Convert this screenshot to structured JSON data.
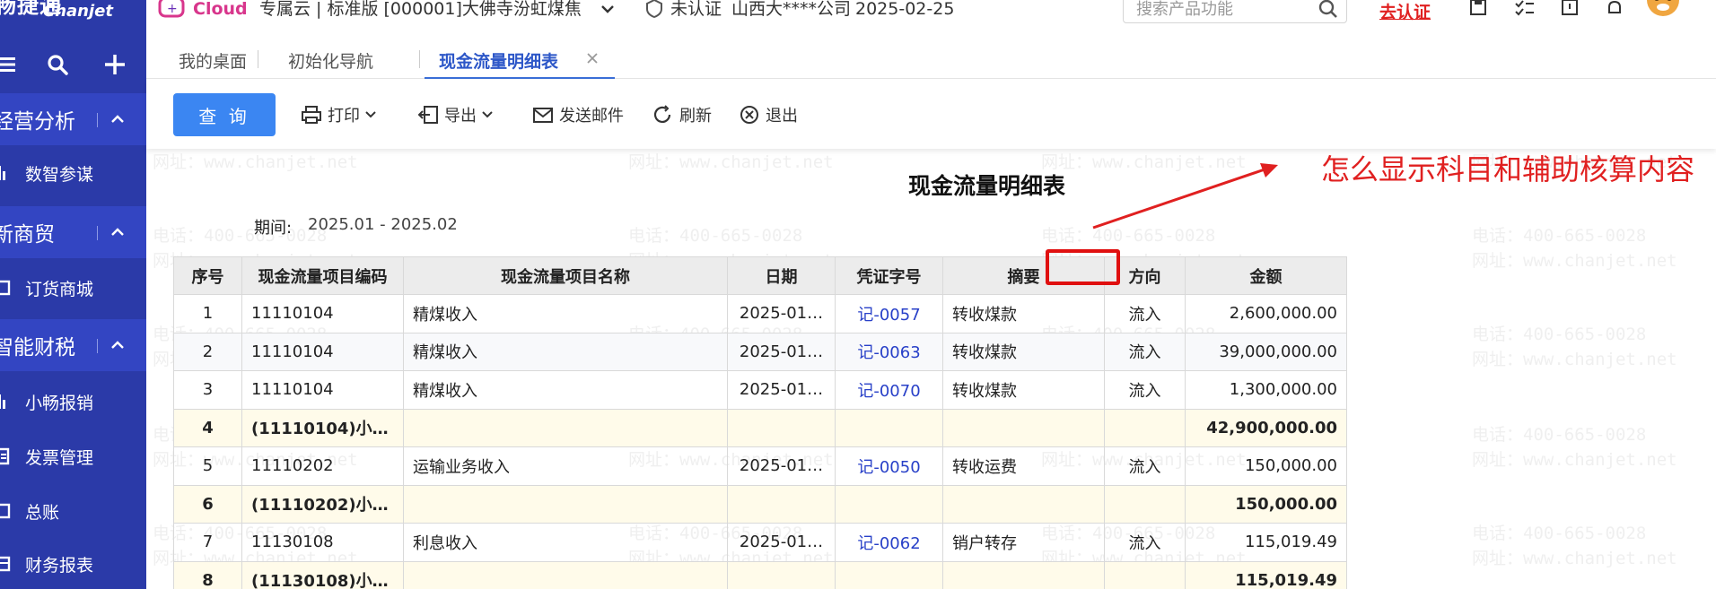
{
  "brand": {
    "logo_text": "畅捷通",
    "logo_subtext": "Chanjet",
    "cloud_text": "Cloud",
    "product_info": "专属云 | 标准版 [000001]大佛寺汾虹煤焦",
    "cert_status": "未认证",
    "company": "山西大****公司",
    "date": "2025-02-25",
    "search_placeholder": "搜索产品功能",
    "certify_link": "去认证"
  },
  "sidebar": {
    "groups": [
      {
        "label": "经营分析",
        "items": [
          {
            "label": "数智参谋"
          }
        ]
      },
      {
        "label": "新商贸",
        "items": [
          {
            "label": "订货商城"
          }
        ]
      },
      {
        "label": "智能财税",
        "items": [
          {
            "label": "小畅报销"
          },
          {
            "label": "发票管理"
          },
          {
            "label": "总账"
          },
          {
            "label": "财务报表"
          }
        ]
      }
    ]
  },
  "tabs": [
    {
      "label": "我的桌面"
    },
    {
      "label": "初始化导航"
    },
    {
      "label": "现金流量明细表"
    }
  ],
  "toolbar": {
    "query": "查 询",
    "print": "打印",
    "export": "导出",
    "send_mail": "发送邮件",
    "refresh": "刷新",
    "exit": "退出"
  },
  "report": {
    "title": "现金流量明细表",
    "period_label": "期间:",
    "period_value": "2025.01 - 2025.02",
    "columns": [
      "序号",
      "现金流量项目编码",
      "现金流量项目名称",
      "日期",
      "凭证字号",
      "摘要",
      "方向",
      "金额"
    ],
    "rows": [
      {
        "no": "1",
        "code": "11110104",
        "name": "精煤收入",
        "date": "2025-01…",
        "voucher": "记-0057",
        "summary": "转收煤款",
        "direction": "流入",
        "amount": "2,600,000.00",
        "subtotal": false
      },
      {
        "no": "2",
        "code": "11110104",
        "name": "精煤收入",
        "date": "2025-01…",
        "voucher": "记-0063",
        "summary": "转收煤款",
        "direction": "流入",
        "amount": "39,000,000.00",
        "subtotal": false
      },
      {
        "no": "3",
        "code": "11110104",
        "name": "精煤收入",
        "date": "2025-01…",
        "voucher": "记-0070",
        "summary": "转收煤款",
        "direction": "流入",
        "amount": "1,300,000.00",
        "subtotal": false
      },
      {
        "no": "4",
        "code": "(11110104)小…",
        "name": "",
        "date": "",
        "voucher": "",
        "summary": "",
        "direction": "",
        "amount": "42,900,000.00",
        "subtotal": true
      },
      {
        "no": "5",
        "code": "11110202",
        "name": "运输业务收入",
        "date": "2025-01…",
        "voucher": "记-0050",
        "summary": "转收运费",
        "direction": "流入",
        "amount": "150,000.00",
        "subtotal": false
      },
      {
        "no": "6",
        "code": "(11110202)小…",
        "name": "",
        "date": "",
        "voucher": "",
        "summary": "",
        "direction": "",
        "amount": "150,000.00",
        "subtotal": true
      },
      {
        "no": "7",
        "code": "11130108",
        "name": "利息收入",
        "date": "2025-01…",
        "voucher": "记-0062",
        "summary": "销户转存",
        "direction": "流入",
        "amount": "115,019.49",
        "subtotal": false
      },
      {
        "no": "8",
        "code": "(11130108)小…",
        "name": "",
        "date": "",
        "voucher": "",
        "summary": "",
        "direction": "",
        "amount": "115,019.49",
        "subtotal": true
      }
    ]
  },
  "annotation": {
    "text": "怎么显示科目和辅助核算内容",
    "color": "#e02020"
  },
  "watermark": {
    "phone": "电话：400-665-0028",
    "site": "网址：www.chanjet.net"
  },
  "colors": {
    "sidebar": "#2b3aa8",
    "primary": "#3b86f2",
    "link": "#2840c8",
    "accent_red": "#e02020"
  }
}
